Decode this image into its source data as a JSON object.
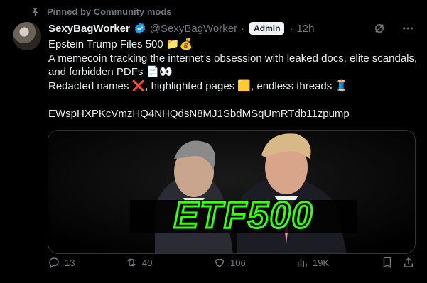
{
  "pinned_label": "Pinned by Community mods",
  "author": {
    "display_name": "SexyBagWorker",
    "handle": "@SexyBagWorker",
    "separator": "·",
    "role_badge": "Admin",
    "time": "12h"
  },
  "post": {
    "line1": "Epstein Trump Files 500 📁💰",
    "line2": "A memecoin tracking the internet’s obsession with leaked docs, elite scandals,",
    "line3": "and forbidden PDFs 📄👀",
    "line4": "Redacted names ❌, highlighted pages 🟨, endless threads 🧵",
    "contract": "EWspHXPKcVmzHQ4NHQdsN8MJ1SbdMSqUmRTdb11zpump"
  },
  "media": {
    "overlay_text": "ETF500"
  },
  "actions": {
    "replies": "13",
    "reposts": "40",
    "likes": "106",
    "views": "19K"
  },
  "colors": {
    "background": "#000000",
    "text": "#e7e9ea",
    "muted": "#71767b",
    "verified": "#1d9bf0",
    "neon_green": "#39ff14"
  }
}
